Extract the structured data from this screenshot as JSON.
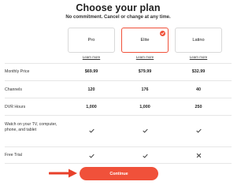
{
  "header": {
    "title": "Choose your plan",
    "subtitle": "No commitment. Cancel or change at any time."
  },
  "plans": [
    {
      "name": "Pro",
      "learn_more": "Learn more",
      "selected": false
    },
    {
      "name": "Elite",
      "learn_more": "Learn more",
      "selected": true
    },
    {
      "name": "Latino",
      "learn_more": "Learn more",
      "selected": false
    }
  ],
  "rows": [
    {
      "label": "Monthly Price",
      "values": [
        "$69.99",
        "$79.99",
        "$32.99"
      ]
    },
    {
      "label": "Channels",
      "values": [
        "120",
        "176",
        "40"
      ]
    },
    {
      "label": "DVR Hours",
      "values": [
        "1,000",
        "1,000",
        "250"
      ]
    },
    {
      "label": "Watch on your TV, computer, phone, and tablet",
      "values": [
        "check-icon",
        "check-icon",
        "check-icon"
      ]
    },
    {
      "label": "Free Trial",
      "values": [
        "check-icon",
        "check-icon",
        "x-icon"
      ]
    }
  ],
  "continue_label": "Continue",
  "colors": {
    "accent": "#f0513a",
    "border": "#d9d9d9",
    "divider": "#e6e6e6"
  }
}
